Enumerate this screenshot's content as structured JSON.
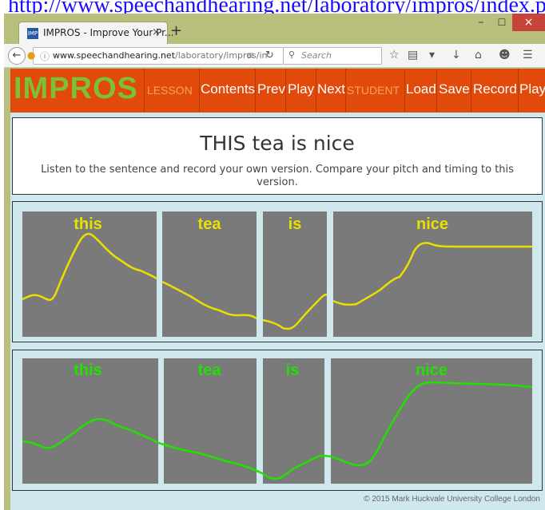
{
  "top_link_text": "http://www.speechandhearing.net/laboratory/impros/index.php",
  "browser": {
    "tab_title": "IMPROS - Improve Your Pr...",
    "tab_close": "×",
    "favicon_text": "IMP",
    "new_tab": "+",
    "window_controls": {
      "minimize": "–",
      "maximize": "☐",
      "close": "×"
    },
    "url_domain": "www.speechandhearing.net",
    "url_path": "/laboratory/impros/in",
    "search_placeholder": "Search",
    "icons": [
      "star-icon",
      "reading-list-icon",
      "pocket-icon",
      "download-icon",
      "home-icon",
      "chat-icon",
      "menu-icon"
    ]
  },
  "app": {
    "logo": "IMPROS",
    "lesson_label": "LESSON",
    "contents": "Contents",
    "prev": "Prev",
    "play": "Play",
    "next": "Next",
    "student_label": "STUDENT",
    "load": "Load",
    "save": "Save",
    "record": "Record",
    "play2": "Play",
    "colors": {
      "bar": "#e24a0b",
      "logo": "#7bbf3a",
      "model_curve": "#e8e000",
      "student_curve": "#22e000",
      "segment_bg": "#7a7a7a"
    }
  },
  "lesson": {
    "title": "THIS tea is nice",
    "instructions": "Listen to the sentence and record your own version. Compare your pitch and timing to this version."
  },
  "model_panel": {
    "words": [
      "this",
      "tea",
      "is",
      "nice"
    ],
    "pitch_levels": [
      0.42,
      0.4,
      0.78,
      0.62,
      0.48,
      0.35,
      0.18,
      0.06,
      0.34,
      0.55,
      0.72
    ]
  },
  "student_panel": {
    "words": [
      "this",
      "tea",
      "is",
      "nice"
    ],
    "pitch_levels": [
      0.32,
      0.5,
      0.38,
      0.22,
      0.06,
      0.22,
      0.16,
      0.86,
      0.82
    ]
  },
  "footer": "© 2015 Mark Huckvale University College London"
}
